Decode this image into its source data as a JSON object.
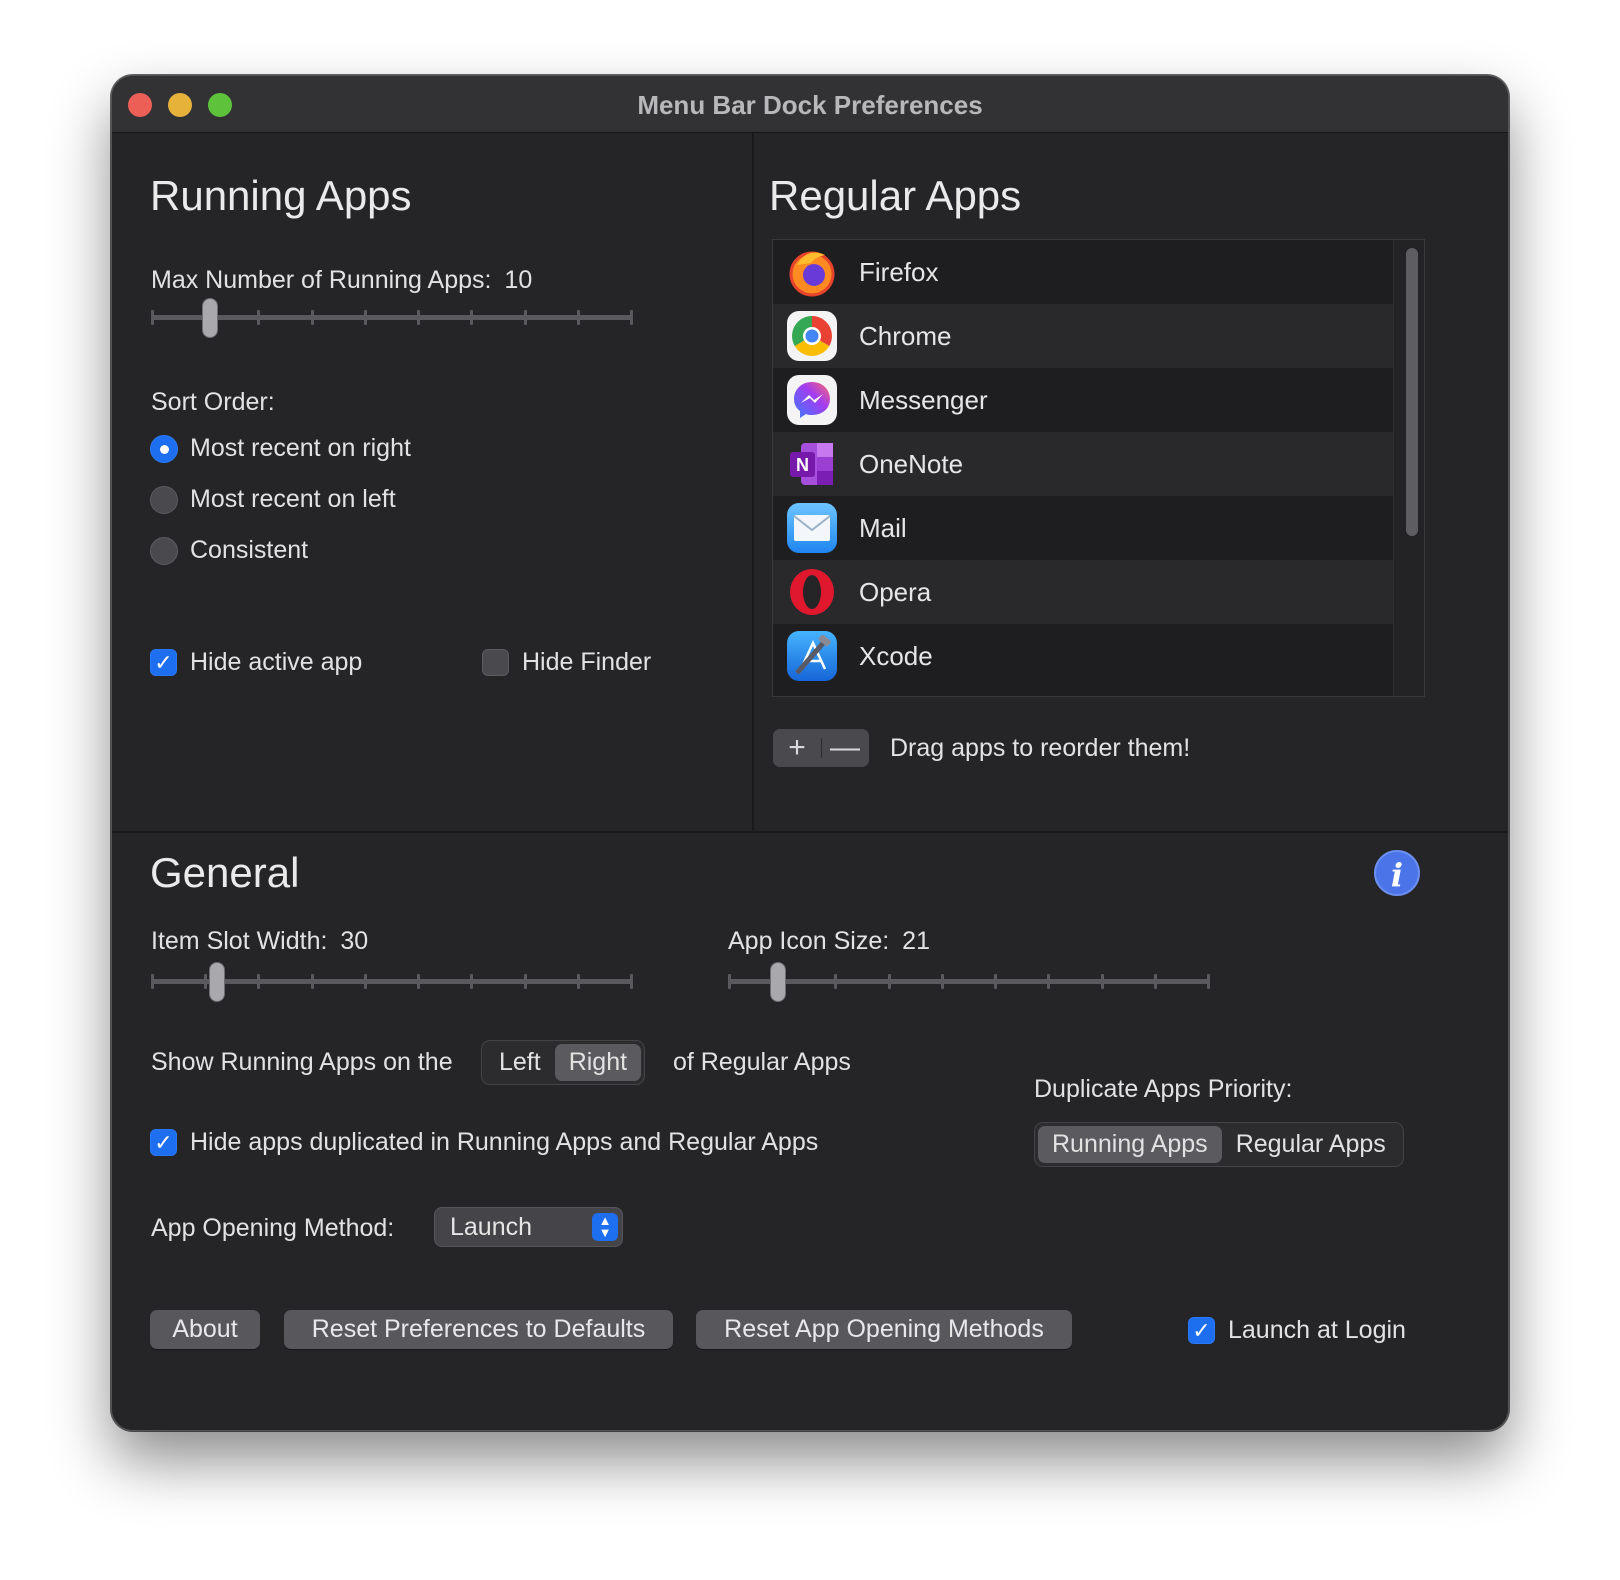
{
  "window": {
    "title": "Menu Bar Dock Preferences"
  },
  "running_apps": {
    "heading": "Running Apps",
    "max_label": "Max Number of Running Apps:",
    "max_value": "10",
    "max_slider_fraction": 0.11,
    "sort_label": "Sort Order:",
    "sort_options": [
      "Most recent on right",
      "Most recent on left",
      "Consistent"
    ],
    "sort_selected": "Most recent on right",
    "hide_active_app_label": "Hide active app",
    "hide_active_app_checked": true,
    "hide_finder_label": "Hide Finder",
    "hide_finder_checked": false
  },
  "regular_apps": {
    "heading": "Regular Apps",
    "apps": [
      {
        "name": "Firefox",
        "icon": "firefox-icon"
      },
      {
        "name": "Chrome",
        "icon": "chrome-icon"
      },
      {
        "name": "Messenger",
        "icon": "messenger-icon"
      },
      {
        "name": "OneNote",
        "icon": "onenote-icon"
      },
      {
        "name": "Mail",
        "icon": "mail-icon"
      },
      {
        "name": "Opera",
        "icon": "opera-icon"
      },
      {
        "name": "Xcode",
        "icon": "xcode-icon"
      }
    ],
    "add_symbol": "+",
    "remove_symbol": "—",
    "hint": "Drag apps to reorder them!"
  },
  "general": {
    "heading": "General",
    "item_slot_label": "Item Slot Width:",
    "item_slot_value": "30",
    "item_slot_fraction": 0.125,
    "icon_size_label": "App Icon Size:",
    "icon_size_value": "21",
    "icon_size_fraction": 0.09,
    "show_running_prefix": "Show Running Apps on the",
    "show_running_options": [
      "Left",
      "Right"
    ],
    "show_running_selected": "Right",
    "show_running_suffix": "of Regular Apps",
    "duplicate_priority_label": "Duplicate Apps Priority:",
    "duplicate_priority_options": [
      "Running Apps",
      "Regular Apps"
    ],
    "duplicate_priority_selected": "Running Apps",
    "hide_duplicates_label": "Hide apps duplicated in Running Apps and Regular Apps",
    "hide_duplicates_checked": true,
    "opening_method_label": "App Opening Method:",
    "opening_method_value": "Launch",
    "about_button": "About",
    "reset_prefs_button": "Reset Preferences to Defaults",
    "reset_methods_button": "Reset App Opening Methods",
    "launch_at_login_label": "Launch at Login",
    "launch_at_login_checked": true,
    "info_symbol": "i"
  },
  "colors": {
    "accent": "#1e6ef0",
    "window_bg": "#252528",
    "titlebar_bg": "#323235",
    "close": "#ec5f57",
    "minimize": "#e6b23a",
    "maximize": "#5fc23b"
  }
}
